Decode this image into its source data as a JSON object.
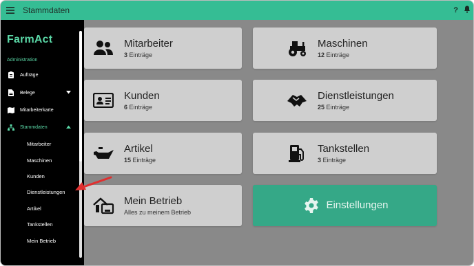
{
  "topbar": {
    "title": "Stammdaten",
    "help": "?"
  },
  "sidebar": {
    "logo": "FarmAct",
    "section": "Administration",
    "items": [
      {
        "label": "Aufträge"
      },
      {
        "label": "Belege"
      },
      {
        "label": "Mitarbeiterkarte"
      },
      {
        "label": "Stammdaten"
      }
    ],
    "subitems": [
      "Mitarbeiter",
      "Maschinen",
      "Kunden",
      "Dienstleistungen",
      "Artikel",
      "Tankstellen",
      "Mein Betrieb"
    ]
  },
  "cards": [
    {
      "name": "Mitarbeiter",
      "count": "3",
      "unit": "Einträge",
      "icon": "people-icon"
    },
    {
      "name": "Maschinen",
      "count": "12",
      "unit": "Einträge",
      "icon": "tractor-icon"
    },
    {
      "name": "Kunden",
      "count": "6",
      "unit": "Einträge",
      "icon": "id-card-icon"
    },
    {
      "name": "Dienstleistungen",
      "count": "25",
      "unit": "Einträge",
      "icon": "handshake-icon"
    },
    {
      "name": "Artikel",
      "count": "15",
      "unit": "Einträge",
      "icon": "oil-can-icon"
    },
    {
      "name": "Tankstellen",
      "count": "3",
      "unit": "Einträge",
      "icon": "gas-pump-icon"
    },
    {
      "name": "Mein Betrieb",
      "sub": "Alles zu meinem Betrieb",
      "icon": "farm-icon"
    },
    {
      "name": "Einstellungen",
      "icon": "gear-icon"
    }
  ],
  "colors": {
    "accent": "#35bd94",
    "accent_dark": "#35a887",
    "sidebar": "#000000",
    "logo": "#5ad7a6"
  }
}
